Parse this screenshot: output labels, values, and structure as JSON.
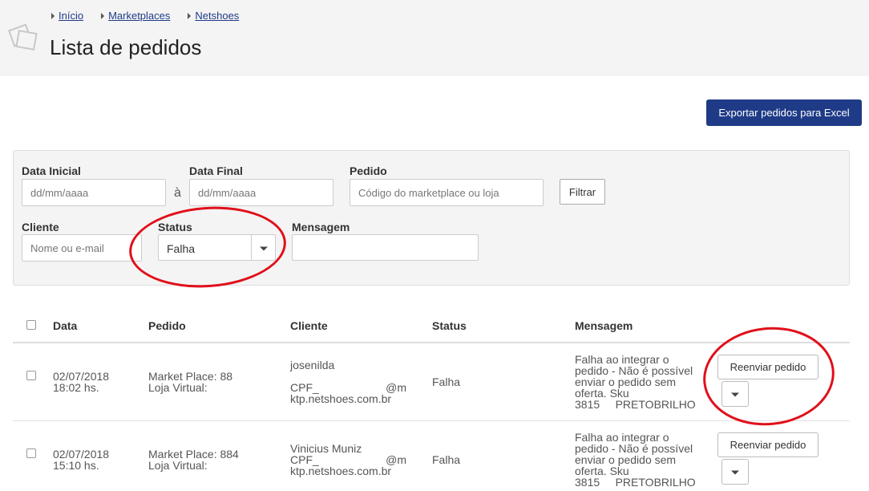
{
  "breadcrumb": [
    "Início",
    "Marketplaces",
    "Netshoes"
  ],
  "page_title": "Lista de pedidos",
  "export_label": "Exportar pedidos para Excel",
  "filters": {
    "data_inicial_label": "Data Inicial",
    "data_inicial_placeholder": "dd/mm/aaaa",
    "separator": "à",
    "data_final_label": "Data Final",
    "data_final_placeholder": "dd/mm/aaaa",
    "pedido_label": "Pedido",
    "pedido_placeholder": "Código do marketplace ou loja",
    "filtrar_label": "Filtrar",
    "cliente_label": "Cliente",
    "cliente_placeholder": "Nome ou e-mail",
    "status_label": "Status",
    "status_value": "Falha",
    "mensagem_label": "Mensagem",
    "mensagem_value": ""
  },
  "table": {
    "headers": [
      "Data",
      "Pedido",
      "Cliente",
      "Status",
      "Mensagem"
    ],
    "rows": [
      {
        "date": "02/07/2018",
        "time": "18:02 hs.",
        "pedido_mp": "Market Place: 88",
        "pedido_lv": "Loja Virtual:",
        "cliente_name": "josenilda",
        "cliente_cpf": "CPF_",
        "cliente_email_end": "@m",
        "cliente_domain": "ktp.netshoes.com.br",
        "status": "Falha",
        "message": [
          "Falha ao integrar o",
          "pedido - Não é possível",
          "enviar o pedido sem",
          "oferta. Sku",
          "3815     PRETOBRILHO"
        ],
        "resend_label": "Reenviar pedido"
      },
      {
        "date": "02/07/2018",
        "time": "15:10 hs.",
        "pedido_mp": "Market Place: 884",
        "pedido_lv": "Loja Virtual:",
        "cliente_name": "Vinicius Muniz",
        "cliente_cpf": "CPF_",
        "cliente_email_end": "@m",
        "cliente_domain": "ktp.netshoes.com.br",
        "status": "Falha",
        "message": [
          "Falha ao integrar o",
          "pedido - Não é possível",
          "enviar o pedido sem",
          "oferta. Sku",
          "3815     PRETOBRILHO"
        ],
        "resend_label": "Reenviar pedido"
      }
    ]
  },
  "colors": {
    "primary": "#1f3b87",
    "annotation": "#e0101a"
  }
}
